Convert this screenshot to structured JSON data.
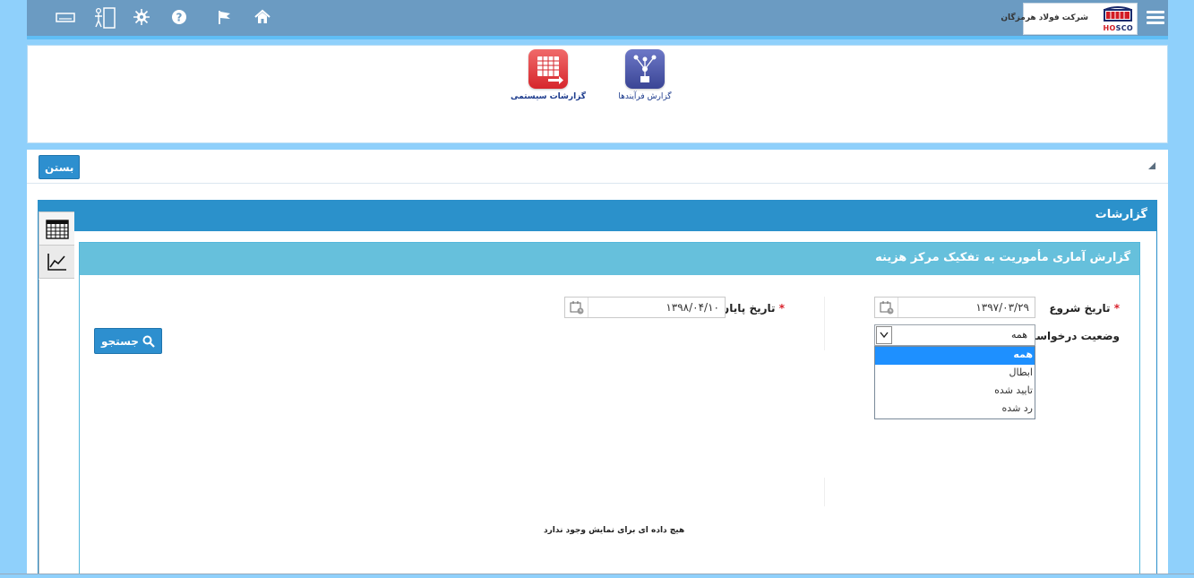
{
  "topbar": {
    "company_name": "شرکت فولاد هرمزگان",
    "brand_prefix": "HO",
    "brand_suffix": "SCO",
    "icons": [
      "keyboard-icon",
      "door-exit-icon",
      "virus-icon",
      "help-icon",
      "flag-icon",
      "home-icon",
      "menu-icon"
    ],
    "accent": "#6b9bc2"
  },
  "launcher": {
    "tiles": [
      {
        "label": "گزارشات سیستمی",
        "icon": "report-table-icon",
        "color": "#d6262c"
      },
      {
        "label": "گزارش فرآیندها",
        "icon": "process-flow-icon",
        "color": "#3a4595"
      }
    ]
  },
  "toolbar": {
    "close_label": "بستن"
  },
  "reports": {
    "title": "گزارشات",
    "side_tabs": [
      "calendar-grid-icon",
      "line-chart-icon"
    ],
    "report": {
      "title": "گزارش آماری مأموریت به تفکیک مرکز هزینه",
      "start_date": {
        "label": "تاریخ شروع",
        "required": "*",
        "value": "۱۳۹۷/۰۳/۲۹"
      },
      "end_date": {
        "label": "تاریخ پایان",
        "required": "*",
        "value": "۱۳۹۸/۰۴/۱۰"
      },
      "status": {
        "label": "وضعیت درخواست",
        "selected": "همه",
        "options": [
          "همه",
          "ابطال",
          "تایید شده",
          "رد شده"
        ]
      },
      "search_label": "جستجو",
      "no_data": "هیچ داده ای برای نمایش وجود ندارد"
    }
  }
}
